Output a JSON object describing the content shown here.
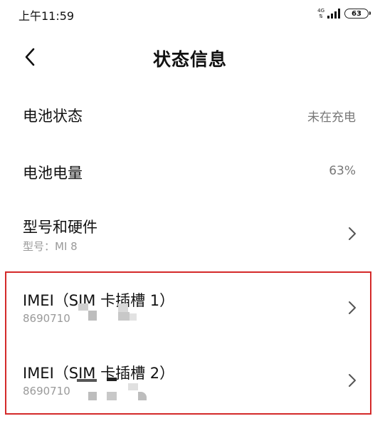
{
  "status_bar": {
    "time": "上午11:59",
    "network_top": "4G",
    "network_bottom": "⇅",
    "battery_level": "63"
  },
  "header": {
    "back_icon": "chevron-left-icon",
    "title": "状态信息"
  },
  "rows": [
    {
      "title": "电池状态",
      "value": "未在充电"
    },
    {
      "title": "电池电量",
      "value": "63%"
    },
    {
      "title": "型号和硬件",
      "subtitle": "型号：MI 8",
      "icon": "chevron-right-icon"
    },
    {
      "title": "IMEI（SIM 卡插槽 1）",
      "subtitle": "8690710",
      "icon": "chevron-right-icon"
    },
    {
      "title": "IMEI（SIM 卡插槽 2）",
      "subtitle": "8690710",
      "icon": "chevron-right-icon"
    }
  ],
  "colors": {
    "highlight": "#d42a2a",
    "primary_text": "#111111",
    "secondary_text": "#9a9a9a"
  }
}
